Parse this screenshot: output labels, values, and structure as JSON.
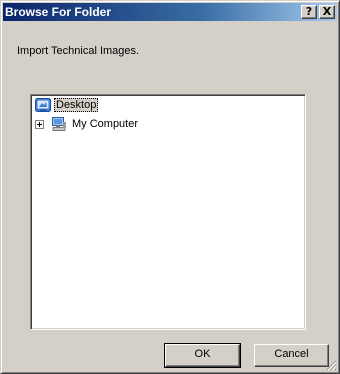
{
  "window": {
    "title": "Browse For Folder",
    "help_label": "?",
    "close_label": "X"
  },
  "instruction": "Import Technical Images.",
  "tree": {
    "root": {
      "label": "Desktop",
      "icon": "desktop-icon",
      "selected": true
    },
    "children": [
      {
        "label": "My Computer",
        "icon": "computer-icon",
        "expander": "plus"
      }
    ]
  },
  "buttons": {
    "ok": "OK",
    "cancel": "Cancel"
  },
  "colors": {
    "titlebar_start": "#0a246a",
    "titlebar_end": "#a6caf0",
    "dialog_face": "#d4d0c8"
  }
}
